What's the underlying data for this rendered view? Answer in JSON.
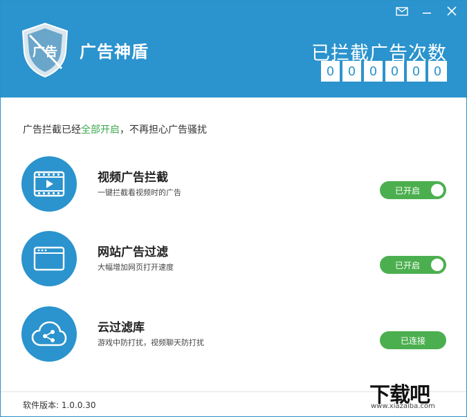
{
  "window": {
    "title": "广告神盾",
    "controls": [
      "mail-icon",
      "minimize-icon",
      "close-icon"
    ]
  },
  "header": {
    "logo_text": "广告",
    "counter_title": "已拦截广告次数",
    "counter_digits": [
      "0",
      "0",
      "0",
      "0",
      "0",
      "0"
    ]
  },
  "status": {
    "prefix": "广告拦截已经",
    "highlight": "全部开启",
    "suffix": "，不再担心广告骚扰",
    "highlight_color": "#3da84f"
  },
  "features": [
    {
      "icon": "video-icon",
      "title": "视频广告拦截",
      "desc": "一键拦截看视频时的广告",
      "state": "已开启"
    },
    {
      "icon": "browser-window-icon",
      "title": "网站广告过滤",
      "desc": "大幅增加网页打开速度",
      "state": "已开启"
    },
    {
      "icon": "cloud-share-icon",
      "title": "云过滤库",
      "desc": "游戏中防打扰，视频聊天防打扰",
      "state": "已连接"
    }
  ],
  "footer": {
    "version": "软件版本: 1.0.0.30"
  },
  "watermark": {
    "text": "下载吧",
    "url": "www.xiazaiba.com"
  },
  "colors": {
    "header_blue": "#2b93cd",
    "toggle_green": "#4caf4f"
  }
}
